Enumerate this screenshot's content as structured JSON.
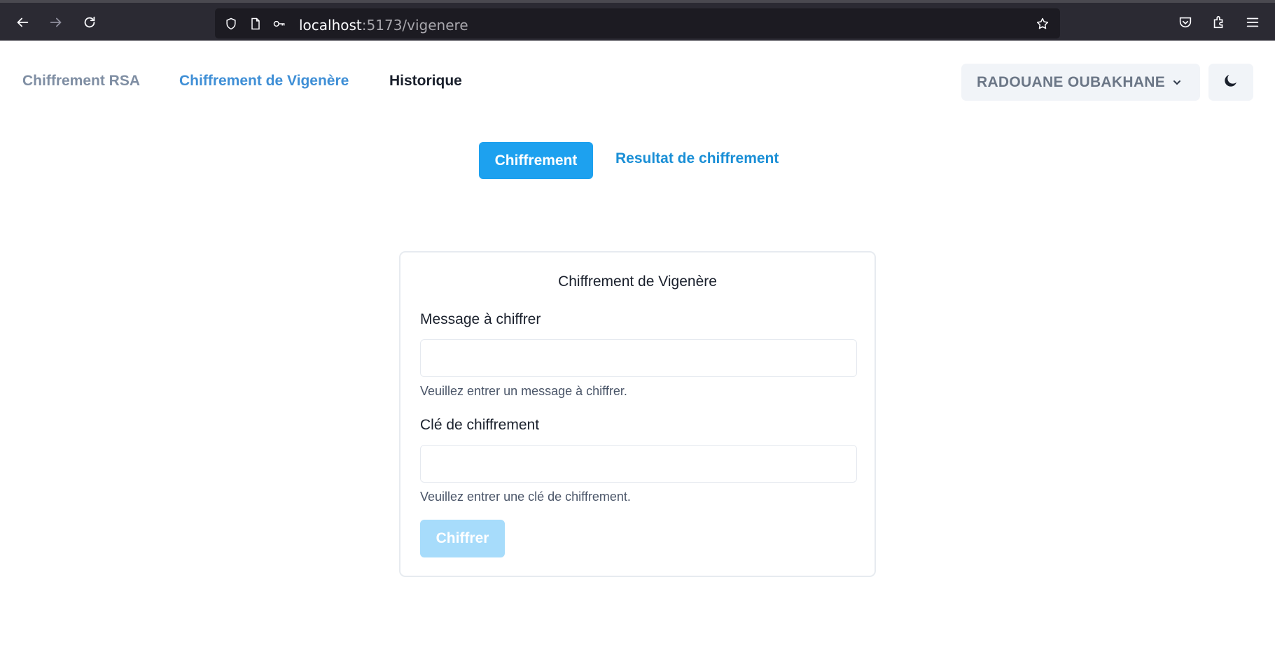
{
  "browser": {
    "url_host": "localhost",
    "url_path": ":5173/vigenere"
  },
  "nav": {
    "links": [
      {
        "label": "Chiffrement RSA"
      },
      {
        "label": "Chiffrement de Vigenère"
      },
      {
        "label": "Historique"
      }
    ],
    "user_name": "RADOUANE OUBAKHANE"
  },
  "tabs": [
    {
      "label": "Chiffrement"
    },
    {
      "label": "Resultat de chiffrement"
    }
  ],
  "form": {
    "title": "Chiffrement de Vigenère",
    "message_label": "Message à chiffrer",
    "message_value": "",
    "message_help": "Veuillez entrer un message à chiffrer.",
    "key_label": "Clé de chiffrement",
    "key_value": "",
    "key_help": "Veuillez entrer une clé de chiffrement.",
    "submit_label": "Chiffrer"
  },
  "colors": {
    "accent": "#1da1ef",
    "nav_active": "#3f8fd6",
    "button_disabled": "#a7dcfb"
  }
}
